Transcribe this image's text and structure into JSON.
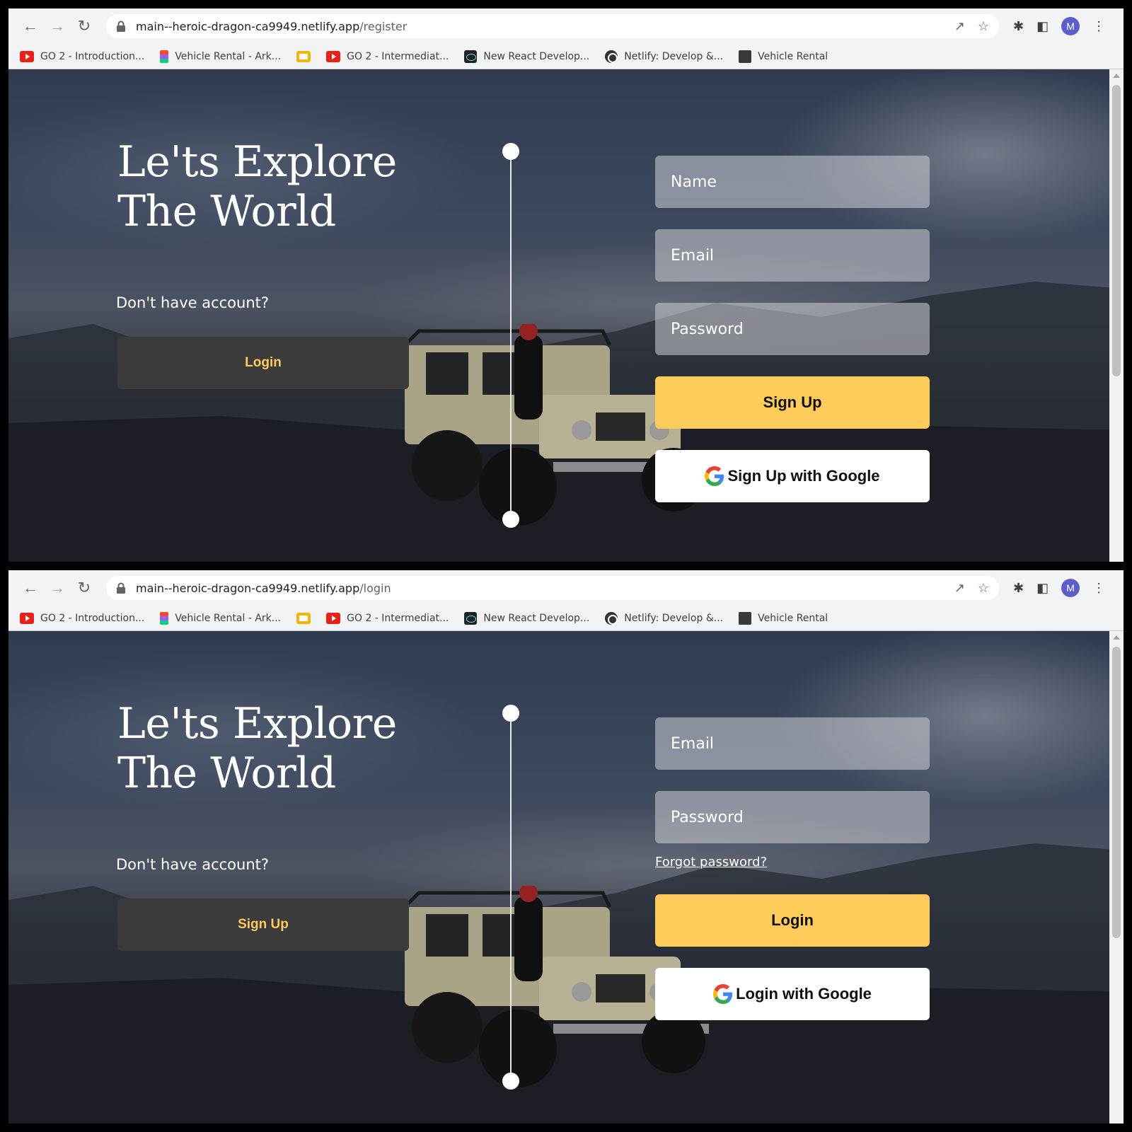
{
  "browser": {
    "bookmarks": [
      {
        "label": "GO 2 - Introduction...",
        "icon": "youtube-icon"
      },
      {
        "label": "Vehicle Rental - Ark...",
        "icon": "figma-icon"
      },
      {
        "label": "",
        "icon": "slides-icon"
      },
      {
        "label": "GO 2 - Intermediat...",
        "icon": "youtube-icon"
      },
      {
        "label": "New React Develop...",
        "icon": "react-icon"
      },
      {
        "label": "Netlify: Develop &...",
        "icon": "netlify-icon"
      },
      {
        "label": "Vehicle Rental",
        "icon": "vehicle-rental-icon"
      }
    ],
    "avatar_letter": "M"
  },
  "register": {
    "url_domain": "main--heroic-dragon-ca9949.netlify.app",
    "url_path": "/register",
    "title_line1": "Le'ts Explore",
    "title_line2": "The World",
    "account_text": "Don't have account?",
    "switch_button": "Login",
    "name_placeholder": "Name",
    "email_placeholder": "Email",
    "password_placeholder": "Password",
    "submit_button": "Sign Up",
    "google_button": "Sign Up with Google"
  },
  "login": {
    "url_domain": "main--heroic-dragon-ca9949.netlify.app",
    "url_path": "/login",
    "title_line1": "Le'ts Explore",
    "title_line2": "The World",
    "account_text": "Don't have account?",
    "switch_button": "Sign Up",
    "email_placeholder": "Email",
    "password_placeholder": "Password",
    "forgot_link": "Forgot password?",
    "submit_button": "Login",
    "google_button": "Login with Google"
  },
  "colors": {
    "accent": "#ffcb5b",
    "dark_button": "#3b3b3b",
    "avatar": "#5b5fc7"
  }
}
